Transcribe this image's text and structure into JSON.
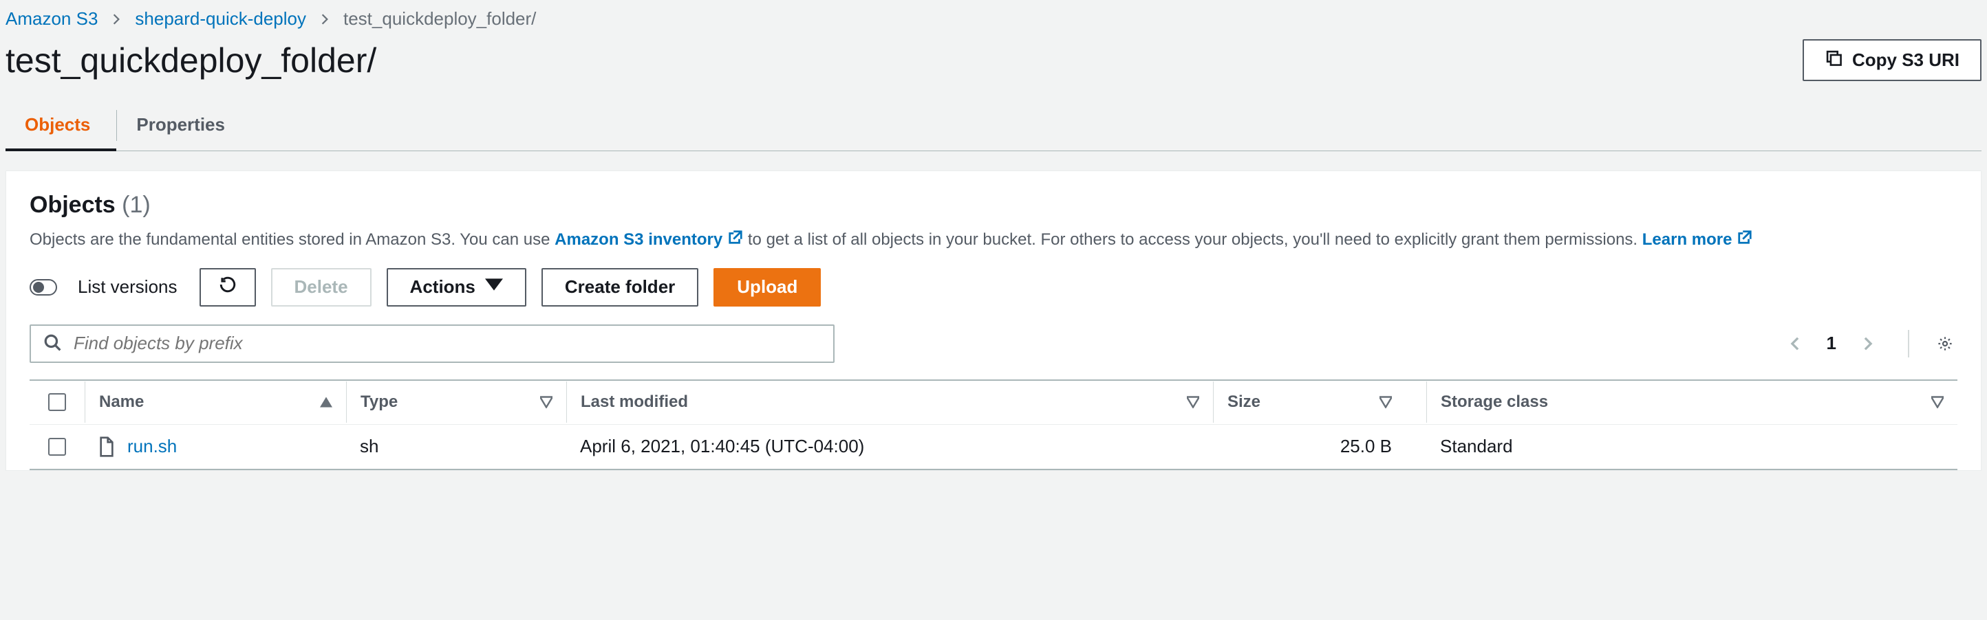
{
  "breadcrumb": {
    "items": [
      {
        "label": "Amazon S3",
        "link": true
      },
      {
        "label": "shepard-quick-deploy",
        "link": true
      },
      {
        "label": "test_quickdeploy_folder/",
        "link": false
      }
    ]
  },
  "header": {
    "title": "test_quickdeploy_folder/",
    "copy_uri_label": "Copy S3 URI"
  },
  "tabs": {
    "objects": "Objects",
    "properties": "Properties"
  },
  "panel": {
    "title": "Objects",
    "count": "(1)",
    "desc_prefix": "Objects are the fundamental entities stored in Amazon S3. You can use ",
    "inventory_link": "Amazon S3 inventory",
    "desc_mid": " to get a list of all objects in your bucket. For others to access your objects, you'll need to explicitly grant them permissions. ",
    "learn_more": "Learn more"
  },
  "toolbar": {
    "list_versions": "List versions",
    "delete": "Delete",
    "actions": "Actions",
    "create_folder": "Create folder",
    "upload": "Upload"
  },
  "search": {
    "placeholder": "Find objects by prefix"
  },
  "pagination": {
    "page": "1"
  },
  "table": {
    "headers": {
      "name": "Name",
      "type": "Type",
      "last_modified": "Last modified",
      "size": "Size",
      "storage_class": "Storage class"
    },
    "rows": [
      {
        "name": "run.sh",
        "type": "sh",
        "last_modified": "April 6, 2021, 01:40:45 (UTC-04:00)",
        "size": "25.0 B",
        "storage_class": "Standard"
      }
    ]
  }
}
